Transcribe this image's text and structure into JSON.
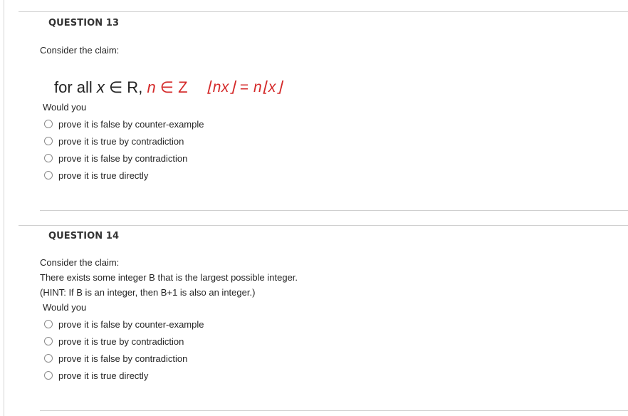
{
  "questions": [
    {
      "heading": "QUESTION 13",
      "intro": "Consider the claim:",
      "claim": {
        "prefix": "for all ",
        "var_x": "x",
        "in_R": " ∈ R, ",
        "var_n": "n",
        "in_Z": " ∈ Z",
        "formula_lhs": "⌊nx⌋",
        "formula_eq": " = ",
        "formula_rhs": "n⌊x⌋"
      },
      "prompt": "Would you",
      "options": [
        {
          "label": "prove it is false by counter-example",
          "selected": false
        },
        {
          "label": "prove it is true by contradiction",
          "selected": false
        },
        {
          "label": "prove it is false by contradiction",
          "selected": false
        },
        {
          "label": "prove it is true directly",
          "selected": false
        }
      ],
      "accent_color": "#d42a2a"
    },
    {
      "heading": "QUESTION 14",
      "intro": "Consider the claim:",
      "statement": "There exists some integer B that is the largest possible integer.",
      "hint": "(HINT: If B is an integer, then B+1 is also an integer.)",
      "prompt": "Would you",
      "options": [
        {
          "label": "prove it is false by counter-example",
          "selected": false
        },
        {
          "label": "prove it is true by contradiction",
          "selected": false
        },
        {
          "label": "prove it is false by contradiction",
          "selected": false
        },
        {
          "label": "prove it is true directly",
          "selected": false
        }
      ]
    }
  ]
}
